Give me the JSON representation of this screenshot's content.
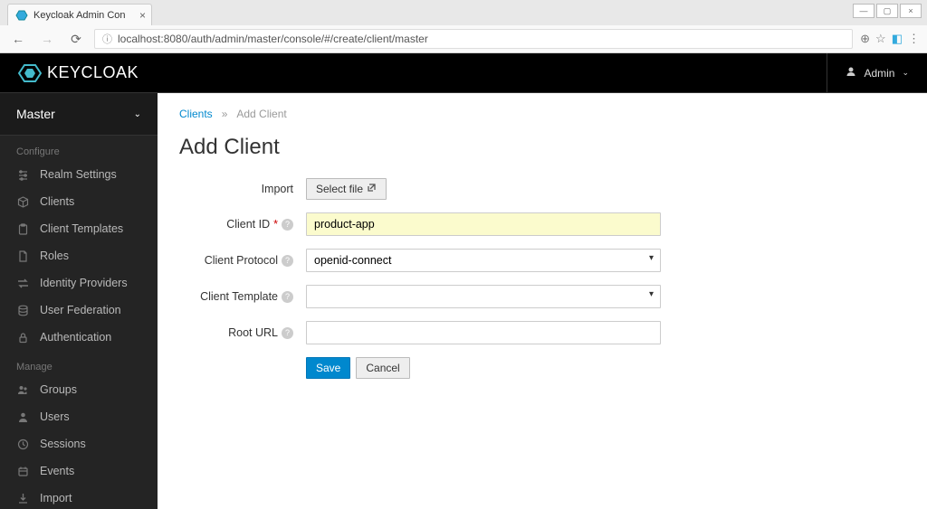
{
  "browser": {
    "tab_title": "Keycloak Admin Con",
    "url": "localhost:8080/auth/admin/master/console/#/create/client/master"
  },
  "header": {
    "brand": "KEYCLOAK",
    "user_label": "Admin"
  },
  "sidebar": {
    "realm": "Master",
    "section_configure": "Configure",
    "section_manage": "Manage",
    "configure": [
      {
        "label": "Realm Settings"
      },
      {
        "label": "Clients"
      },
      {
        "label": "Client Templates"
      },
      {
        "label": "Roles"
      },
      {
        "label": "Identity Providers"
      },
      {
        "label": "User Federation"
      },
      {
        "label": "Authentication"
      }
    ],
    "manage": [
      {
        "label": "Groups"
      },
      {
        "label": "Users"
      },
      {
        "label": "Sessions"
      },
      {
        "label": "Events"
      },
      {
        "label": "Import"
      }
    ]
  },
  "breadcrumbs": {
    "parent": "Clients",
    "sep": "»",
    "current": "Add Client"
  },
  "page": {
    "title": "Add Client"
  },
  "form": {
    "import_label": "Import",
    "select_file_btn": "Select file",
    "client_id_label": "Client ID",
    "client_id_value": "product-app",
    "client_protocol_label": "Client Protocol",
    "client_protocol_value": "openid-connect",
    "client_template_label": "Client Template",
    "client_template_value": "",
    "root_url_label": "Root URL",
    "root_url_value": "",
    "save_btn": "Save",
    "cancel_btn": "Cancel"
  }
}
